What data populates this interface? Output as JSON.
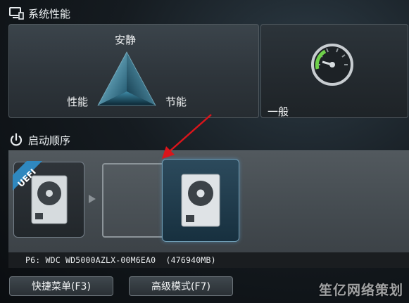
{
  "system_performance": {
    "title": "系统性能",
    "mode_quiet": "安静",
    "mode_performance": "性能",
    "mode_energy": "节能",
    "normal_label": "一般"
  },
  "boot_priority": {
    "title": "启动顺序",
    "uefi_badge": "UEFI",
    "device_info": "P6: WDC WD5000AZLX-00M6EA0  (476940MB)"
  },
  "buttons": {
    "ez_tuning": "快捷菜单(F3)",
    "advanced_mode": "高级模式(F7)"
  },
  "watermark": "笙亿网络策划",
  "icons": {
    "monitor": "monitor-icon",
    "power": "power-icon",
    "gauge": "speedometer-icon",
    "disk": "hard-disk-icon",
    "arrow": "red-arrow"
  },
  "colors": {
    "selected_disk": "#17303f",
    "annotation_arrow": "#d9151b"
  }
}
